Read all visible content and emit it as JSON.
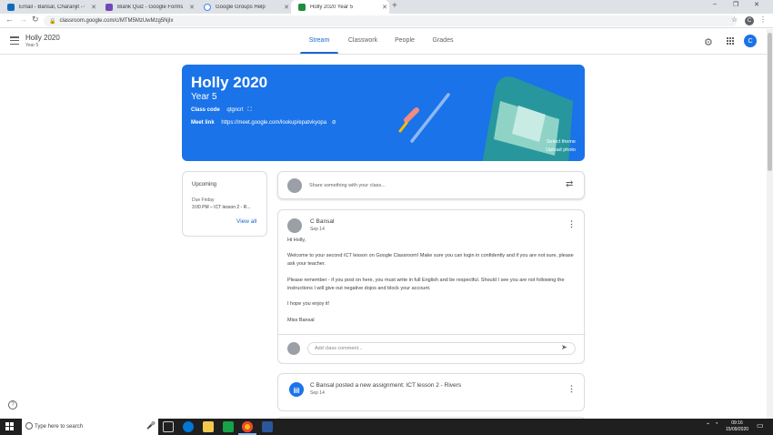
{
  "browser": {
    "tabs": [
      {
        "title": "Email - Bansal, Charanjit - Outlo",
        "color": "#0f6cbd"
      },
      {
        "title": "Blank Quiz - Google Forms",
        "color": "#7248b9"
      },
      {
        "title": "Google Groups Help",
        "color": "#4285f4"
      },
      {
        "title": "Holly 2020 Year 5",
        "color": "#1e8e3e"
      }
    ],
    "new_tab": "+",
    "url": "classroom.google.com/c/MTM5MzUwMzg5NjIx",
    "profile": "C",
    "window_controls": [
      "–",
      "❐",
      "✕"
    ]
  },
  "classroom": {
    "class_name": "Holly 2020",
    "section": "Year 5",
    "tabs": [
      "Stream",
      "Classwork",
      "People",
      "Grades"
    ],
    "avatar": "C"
  },
  "banner": {
    "title": "Holly 2020",
    "subtitle": "Year 5",
    "class_code_label": "Class code",
    "class_code": "qtgncrt",
    "meet_label": "Meet link",
    "meet_url": "https://meet.google.com/lookup/epatvkyopa",
    "select_theme": "Select theme",
    "upload_photo": "Upload photo",
    "color": "#1a73e8"
  },
  "upcoming": {
    "title": "Upcoming",
    "due": "Due Friday",
    "task": "3:00 PM – ICT lesson 2 - R...",
    "view_all": "View all"
  },
  "share": {
    "placeholder": "Share something with your class..."
  },
  "post": {
    "author": "C Bansal",
    "date": "Sep 14",
    "greeting": "Hi Holly,",
    "p1": "Welcome to your second ICT lesson on Google Classroom! Make sure you can login in confidently and if you are not sure, please ask your teacher.",
    "p2": "Please remember - if you post on here, you must write in full English and be respectful. Should I see you are not following the instructions I will give out negative dojos and block your account.",
    "p3": "I hope you enjoy it!",
    "sign": "Miss Bansal",
    "comment_placeholder": "Add class comment..."
  },
  "assignment": {
    "text": "C Bansal posted a new assignment: ICT lesson 2 - Rivers",
    "date": "Sep 14"
  },
  "taskbar": {
    "search": "Type here to search",
    "time": "09:16",
    "date": "15/09/2020"
  }
}
